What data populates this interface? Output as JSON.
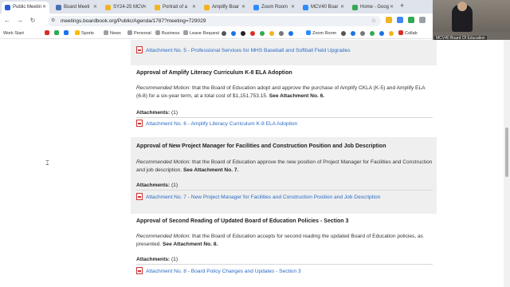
{
  "tabs": [
    {
      "title": "Public Meetin",
      "color": "#2a5bd7",
      "active": true
    },
    {
      "title": "Board Meeti",
      "color": "#4a6fb5",
      "active": false
    },
    {
      "title": "SY24-25 MCV",
      "color": "#f3b321",
      "active": false
    },
    {
      "title": "Portrait of a",
      "color": "#f3b321",
      "active": false
    },
    {
      "title": "Amplify Boar",
      "color": "#f3b321",
      "active": false
    },
    {
      "title": "Zoom Room",
      "color": "#2d8cff",
      "active": false
    },
    {
      "title": "MCV40 Boar",
      "color": "#2d8cff",
      "active": false
    },
    {
      "title": "Home - Goog",
      "color": "#34a853",
      "active": false
    }
  ],
  "address": "meetings.boardbook.org/Public/Agenda/1787?meeting=729029",
  "bookmarks": [
    {
      "label": "Work Start",
      "color": "#5f6368"
    },
    {
      "label": "",
      "color": "#34a853"
    },
    {
      "label": "",
      "color": "#1a73e8"
    },
    {
      "label": "",
      "color": "#fbbc04"
    },
    {
      "label": "Sports",
      "color": "#5f6368"
    },
    {
      "label": "News",
      "color": "#5f6368"
    },
    {
      "label": "Personal",
      "color": "#5f6368"
    },
    {
      "label": "Business",
      "color": "#5f6368"
    },
    {
      "label": "Leave Request",
      "color": "#5f6368"
    },
    {
      "label": "Zoom Room",
      "color": "#2d8cff"
    },
    {
      "label": "Collab",
      "color": "#d93025"
    }
  ],
  "video": {
    "label": "MCV40 Board Of Education"
  },
  "agenda": {
    "top_attachment": "Attachment No. 5 - Professional Services for MHS Baseball and Softball Field Upgrades",
    "items": [
      {
        "heading": "Approval of Amplify Literacy Curriculum K-8 ELA Adoption",
        "motion_label": "Recommended Motion:",
        "motion_text": " that the Board of Education adopt and approve the purchase of Amplify CKLA (K-5) and Amplify ELA (6-8) for a six-year term, at a total cost of $1,151,753.15. ",
        "motion_ref": "See Attachment No. 6.",
        "attachments_label": "Attachments:",
        "attachments_count": "(1)",
        "attachment": "Attachment No. 6 - Amplify Literacy Curriculum K-8 ELA Adoption"
      },
      {
        "heading": "Approval of New Project Manager for Facilities and Construction Position and Job Description",
        "motion_label": "Recommended Motion:",
        "motion_text": " that the Board of Education approve the new position of Project Manager for Facilities and Construction and job description. ",
        "motion_ref": "See Attachment No. 7.",
        "attachments_label": "Attachments:",
        "attachments_count": "(1)",
        "attachment": "Attachment No. 7 - New Project Manager for Facilities and Construction Position and Job Description"
      },
      {
        "heading": "Approval of Second Reading of Updated Board of Education Policies - Section 3",
        "motion_label": "Recommended Motion:",
        "motion_text": " that the Board of Education accepts for second reading the updated Board of Education policies, as presented. ",
        "motion_ref": "See Attachment No. 8.",
        "attachments_label": "Attachments:",
        "attachments_count": "(1)",
        "attachment": "Attachment No. 8 - Board Policy Changes and Updates - Section 3"
      }
    ]
  }
}
